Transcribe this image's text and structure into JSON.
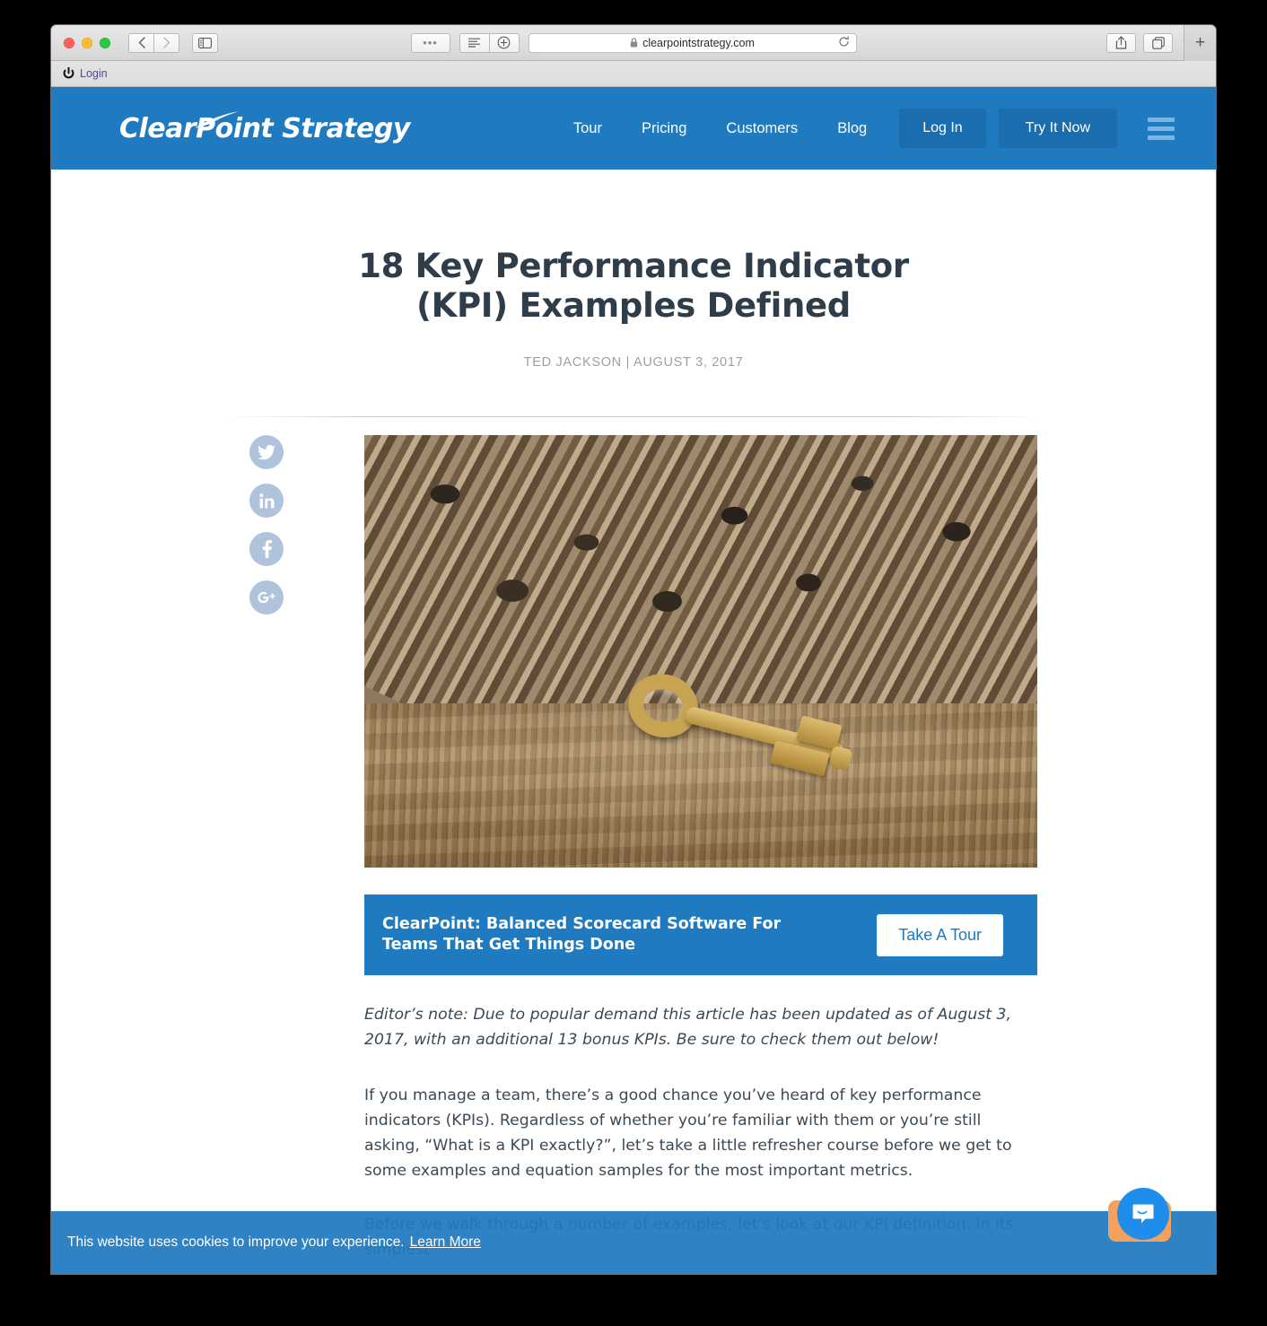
{
  "browser": {
    "url": "clearpointstrategy.com",
    "lock_icon": "lock-icon",
    "reload_icon": "reload-icon",
    "back_icon": "back-arrow-icon",
    "forward_icon": "forward-arrow-icon",
    "sidebar_icon": "sidebar-icon",
    "dots_icon": "ellipsis-icon",
    "reader_icon": "reader-view-icon",
    "zoom_icon": "zoom-in-icon",
    "share_icon": "share-icon",
    "tabs_icon": "tab-overview-icon",
    "new_tab_label": "+",
    "bookmark": {
      "icon": "power-icon",
      "label": "Login"
    }
  },
  "site_header": {
    "logo_text": "ClearPoint Strategy",
    "nav_links": [
      {
        "label": "Tour"
      },
      {
        "label": "Pricing"
      },
      {
        "label": "Customers"
      },
      {
        "label": "Blog"
      }
    ],
    "login_label": "Log In",
    "trial_label": "Try It Now",
    "menu_icon": "hamburger-menu-icon",
    "background_color": "#1f7ac0",
    "button_color": "#1a6dae"
  },
  "article": {
    "title": "18 Key Performance Indicator (KPI) Examples Defined",
    "author": "TED JACKSON",
    "separator": "|",
    "date": "AUGUST 3, 2017",
    "byline": "TED JACKSON  |  AUGUST 3, 2017",
    "hero_alt": "Pile of rusty antique keys on a wooden board with one polished gold skeleton key",
    "paragraphs": [
      "Editor’s note: Due to popular demand this article has been updated as of August 3, 2017, with an additional 13 bonus KPIs. Be sure to check them out below!",
      "If you manage a team, there’s a good chance you’ve heard of key performance indicators (KPIs). Regardless of whether you’re familiar with them or you’re still asking, “What is a KPI exactly?”, let’s take a little refresher course before we get to some examples and equation samples for the most important metrics.",
      "Before we walk through a number of examples, let’s look at our KPI definition. In its simplest"
    ]
  },
  "share": {
    "items": [
      {
        "name": "twitter-icon",
        "label": "Share on Twitter"
      },
      {
        "name": "linkedin-icon",
        "label": "Share on LinkedIn"
      },
      {
        "name": "facebook-icon",
        "label": "Share on Facebook"
      },
      {
        "name": "googleplus-icon",
        "label": "Share on Google Plus"
      }
    ],
    "color": "#afc3dc"
  },
  "cta": {
    "headline": "ClearPoint: Balanced Scorecard Software For Teams That Get Things Done",
    "button_label": "Take A Tour",
    "background_color": "#1f7ac0"
  },
  "cookie_banner": {
    "text": "This website uses cookies to improve your experience.",
    "link_label": "Learn More",
    "background_color": "#1f7ac0"
  },
  "chat_widget": {
    "icon": "chat-bubble-icon",
    "color": "#1f8deb",
    "card_color": "#f2a25c"
  }
}
